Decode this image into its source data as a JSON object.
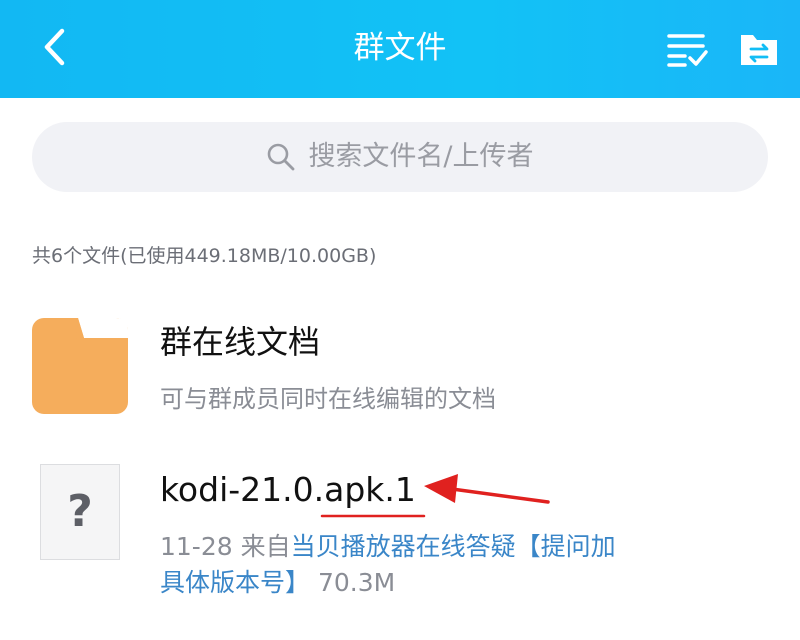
{
  "header": {
    "title": "群文件",
    "back_icon": "chevron-left-icon",
    "multi_select_icon": "list-check-icon",
    "transfer_icon": "file-transfer-icon",
    "background_color": "#12bdf5"
  },
  "search": {
    "placeholder": "搜索文件名/上传者",
    "icon": "search-icon"
  },
  "summary": "共6个文件(已使用449.18MB/10.00GB)",
  "files": [
    {
      "name": "群在线文档",
      "subtitle": "可与群成员同时在线编辑的文档",
      "icon": "folder-icon",
      "icon_color": "#f5ad5c"
    },
    {
      "name": "kodi-21.0.apk.1",
      "icon": "unknown-file-icon",
      "icon_symbol": "?",
      "date": "11-28",
      "from_label": "来自",
      "uploader": "当贝播放器在线答疑【提问加",
      "uploader_cont": "具体版本号】",
      "size": "70.3M"
    }
  ],
  "annotation": {
    "color": "#e0211f",
    "type": "red arrow pointing to file name with underline"
  }
}
